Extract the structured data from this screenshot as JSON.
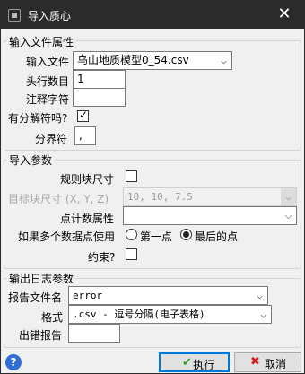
{
  "window": {
    "title": "导入质心",
    "close_glyph": "✕"
  },
  "input_props": {
    "group_title": "输入文件属性",
    "file_label": "输入文件",
    "file_value": "乌山地质模型0_54.csv",
    "header_rows_label": "头行数目",
    "header_rows_value": "1",
    "comment_char_label": "注释字符",
    "comment_char_value": "",
    "has_delimiter_label": "有分解符吗?",
    "has_delimiter_checked": true,
    "delimiter_label": "分界符",
    "delimiter_value": ","
  },
  "import_params": {
    "group_title": "导入参数",
    "regular_block_label": "规则块尺寸",
    "regular_block_checked": false,
    "target_block_label": "目标块尺寸 (X, Y, Z)",
    "target_block_value": "10, 10, 7.5",
    "point_count_label": "点计数属性",
    "point_count_value": "",
    "multi_points_label": "如果多个数据点使用",
    "radio_first_label": "第一点",
    "radio_last_label": "最后的点",
    "selected_option": "最后的点",
    "constrain_label": "约束?",
    "constrain_checked": false
  },
  "output_log": {
    "group_title": "输出日志参数",
    "report_file_label": "报告文件名",
    "report_file_value": "error",
    "format_label": "格式",
    "format_value": ".csv - 逗号分隔(电子表格)",
    "error_report_label": "出错报告",
    "error_report_value": ""
  },
  "footer": {
    "help_glyph": "?",
    "ok_label": "执行",
    "cancel_label": "取消",
    "ok_glyph": "✔",
    "cancel_glyph": "✖"
  },
  "colors": {
    "titlebar": "#2b2b2b",
    "background": "#f0f0f0",
    "accent": "#0078d7",
    "ok_icon": "#2e9e2e",
    "cancel_icon": "#d11f1f",
    "help": "#2f6fd6"
  },
  "icons": {
    "app": "app-icon",
    "close": "close-icon",
    "help": "help-icon",
    "ok": "checkmark-icon",
    "cancel": "cross-icon"
  }
}
